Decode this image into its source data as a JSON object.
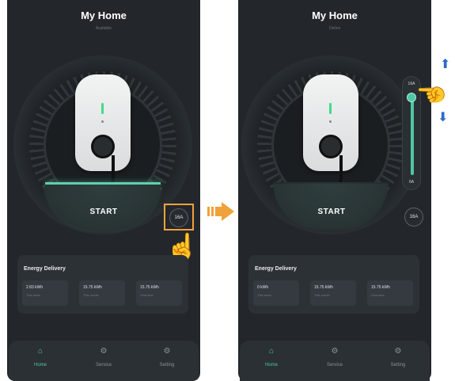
{
  "left_screen": {
    "title": "My Home",
    "status": "Available",
    "start_label": "START",
    "current_badge": "16A",
    "energy": {
      "title": "Energy Delivery",
      "stats": [
        {
          "value": "2.83 kWh",
          "label": "This week"
        },
        {
          "value": "15.75 kWh",
          "label": "This month"
        },
        {
          "value": "15.75 kWh",
          "label": "Overview"
        }
      ]
    },
    "nav": [
      {
        "label": "Home",
        "icon": "home-icon",
        "active": true
      },
      {
        "label": "Service",
        "icon": "service-icon",
        "active": false
      },
      {
        "label": "Setting",
        "icon": "setting-icon",
        "active": false
      }
    ]
  },
  "right_screen": {
    "title": "My Home",
    "status": "Online",
    "start_label": "START",
    "current_badge": "16A",
    "slider": {
      "max_label": "16A",
      "min_label": "6A",
      "level": 0.92
    },
    "energy": {
      "title": "Energy Delivery",
      "stats": [
        {
          "value": "0 kWh",
          "label": "This week"
        },
        {
          "value": "15.75 kWh",
          "label": "This month"
        },
        {
          "value": "15.75 kWh",
          "label": "Overview"
        }
      ]
    },
    "nav": [
      {
        "label": "Home",
        "icon": "home-icon",
        "active": true
      },
      {
        "label": "Service",
        "icon": "service-icon",
        "active": false
      },
      {
        "label": "Setting",
        "icon": "setting-icon",
        "active": false
      }
    ]
  },
  "colors": {
    "accent": "#4ec79d",
    "highlight": "#f0a23a",
    "arrow": "#f0a23a",
    "updown_arrows": "#2a6ac9",
    "background": "#23272c"
  }
}
